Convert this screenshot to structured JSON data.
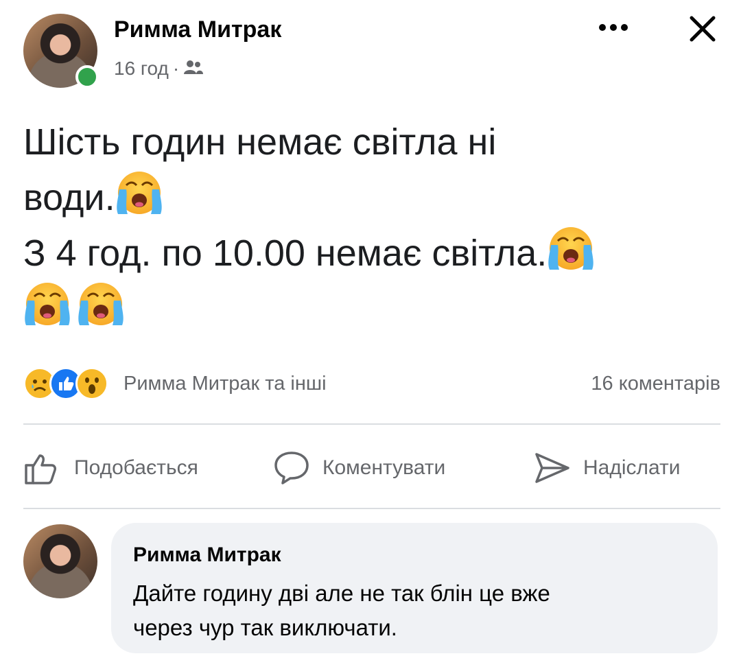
{
  "post": {
    "author": "Римма Митрак",
    "time": "16 год",
    "separator": "·",
    "audience_icon": "friends-icon",
    "text_line1": "Шість годин немає світла ні",
    "text_line2": "води.",
    "text_line3": "З 4 год. по 10.00 немає світла.",
    "emoji": "loudly-crying-face"
  },
  "reactions": {
    "icons": [
      "sad-reaction-icon",
      "like-reaction-icon",
      "wow-reaction-icon"
    ],
    "summary": "Римма Митрак та інші",
    "comments": "16 коментарів"
  },
  "actions": {
    "like": "Подобається",
    "comment": "Коментувати",
    "share": "Надіслати"
  },
  "comment": {
    "author": "Римма Митрак",
    "line1": "Дайте годину дві але не так блін це вже",
    "line2": "через чур так виключати."
  },
  "colors": {
    "online": "#31a24c",
    "secondary_text": "#65676b",
    "like_blue": "#1877f2",
    "bubble": "#f0f2f5"
  }
}
